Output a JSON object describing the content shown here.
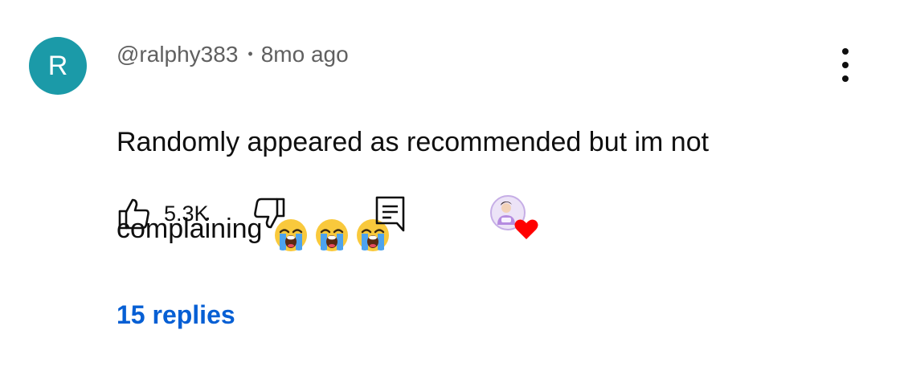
{
  "comment": {
    "avatar_letter": "R",
    "avatar_color": "#1b9aa8",
    "author": "@ralphy383",
    "separator": "•",
    "time_ago": "8mo ago",
    "text_line1": "Randomly appeared as recommended but im not",
    "text_line2": "complaining",
    "emoji": [
      "loudly-crying-face",
      "loudly-crying-face",
      "loudly-crying-face"
    ],
    "like_count": "5.3K",
    "creator_heart": true,
    "replies_label": "15 replies",
    "replies_color": "#065fd4"
  },
  "icons": {
    "more": "more-vertical-icon",
    "like": "thumbs-up-icon",
    "dislike": "thumbs-down-icon",
    "reply": "reply-comment-icon",
    "heart": "creator-heart-icon"
  }
}
